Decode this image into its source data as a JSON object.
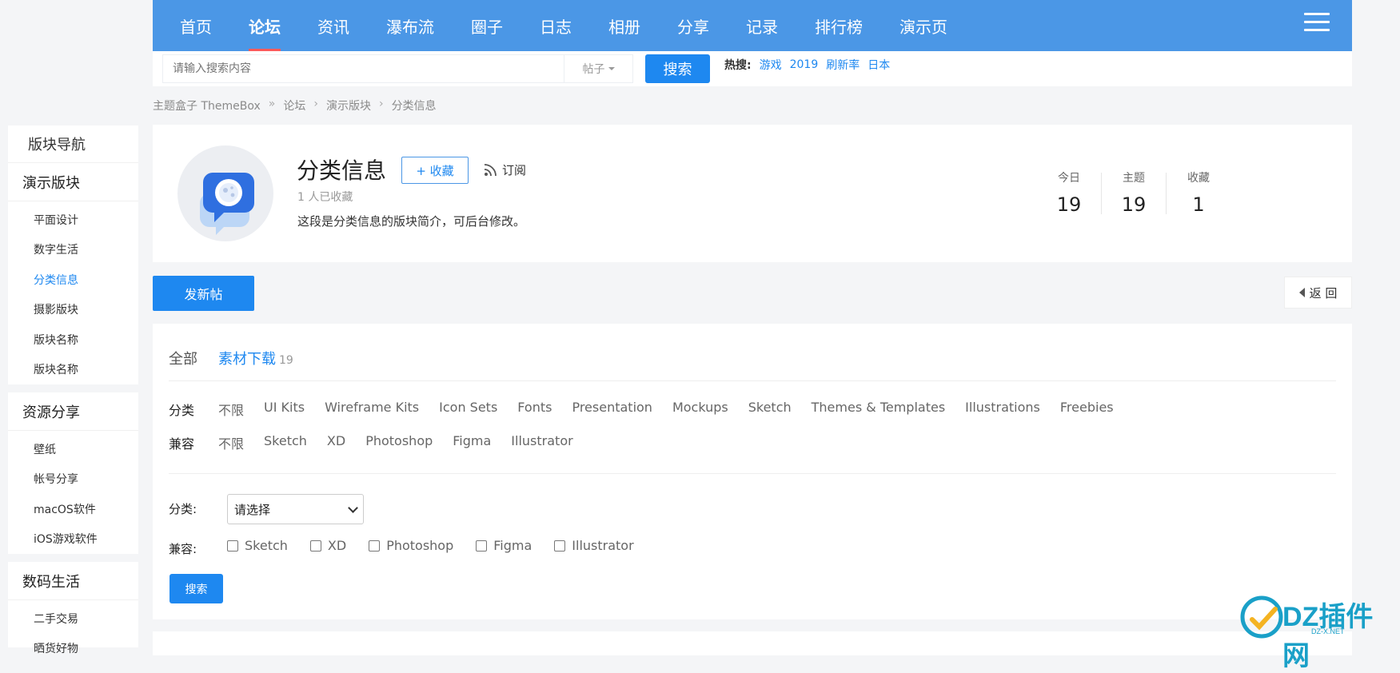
{
  "nav": {
    "items": [
      "首页",
      "论坛",
      "资讯",
      "瀑布流",
      "圈子",
      "日志",
      "相册",
      "分享",
      "记录",
      "排行榜",
      "演示页"
    ],
    "active_index": 1
  },
  "search": {
    "placeholder": "请输入搜索内容",
    "type_label": "帖子",
    "button_label": "搜索",
    "hot_label": "热搜:",
    "hot_terms": [
      "游戏",
      "2019",
      "刷新率",
      "日本"
    ]
  },
  "breadcrumb": [
    "主题盒子 ThemeBox",
    "»",
    "论坛",
    "›",
    "演示版块",
    "›",
    "分类信息"
  ],
  "sidebar": {
    "header": "版块导航",
    "groups": [
      {
        "title": "演示版块",
        "items": [
          "平面设计",
          "数字生活",
          "分类信息",
          "摄影版块",
          "版块名称",
          "版块名称"
        ]
      },
      {
        "title": "资源分享",
        "items": [
          "壁纸",
          "帐号分享",
          "macOS软件",
          "iOS游戏软件"
        ]
      },
      {
        "title": "数码生活",
        "items": [
          "二手交易",
          "晒货好物"
        ]
      }
    ],
    "active_item": "分类信息"
  },
  "forum": {
    "title": "分类信息",
    "fav_button": "+ 收藏",
    "subscribe_label": "订阅",
    "fav_count": "1 人已收藏",
    "description": "这段是分类信息的版块简介，可后台修改。",
    "stats": [
      {
        "label": "今日",
        "value": "19"
      },
      {
        "label": "主题",
        "value": "19"
      },
      {
        "label": "收藏",
        "value": "1"
      }
    ]
  },
  "actions": {
    "new_post": "发新帖",
    "back": "返 回"
  },
  "filter": {
    "tabs": [
      {
        "label": "全部",
        "count": ""
      },
      {
        "label": "素材下载",
        "count": "19"
      }
    ],
    "category_label": "分类",
    "category_options": [
      "不限",
      "UI Kits",
      "Wireframe Kits",
      "Icon Sets",
      "Fonts",
      "Presentation",
      "Mockups",
      "Sketch",
      "Themes & Templates",
      "Illustrations",
      "Freebies"
    ],
    "compat_label": "兼容",
    "compat_options": [
      "不限",
      "Sketch",
      "XD",
      "Photoshop",
      "Figma",
      "Illustrator"
    ],
    "select_label": "分类:",
    "select_value": "请选择",
    "checkbox_label": "兼容:",
    "checkboxes": [
      "Sketch",
      "XD",
      "Photoshop",
      "Figma",
      "Illustrator"
    ],
    "search_button": "搜索"
  },
  "watermark": {
    "text": "DZ插件网",
    "sub": "DZ-X.NET"
  },
  "colors": {
    "nav": "#4b97e6",
    "accent": "#1e88f0",
    "nav_active_underline": "#ff5a5a"
  }
}
